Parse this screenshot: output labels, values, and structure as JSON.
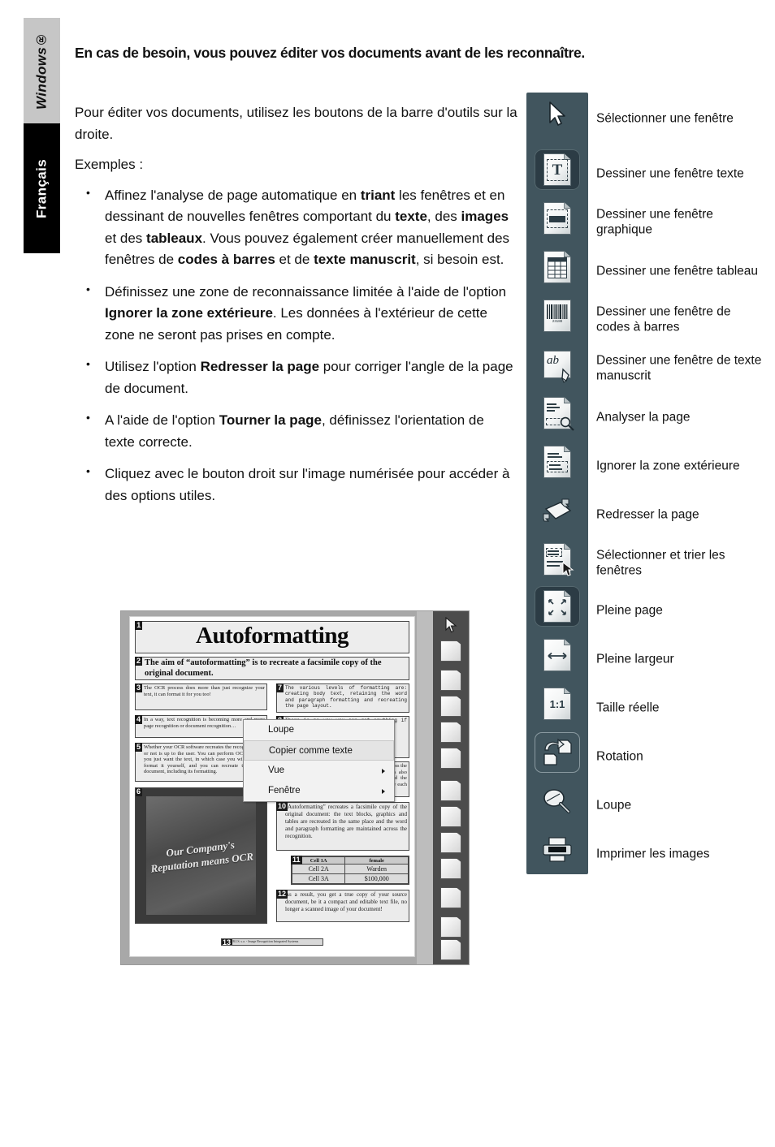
{
  "side_tabs": {
    "windows": "Windows®",
    "francais": "Français"
  },
  "heading": "En cas de besoin, vous pouvez éditer vos documents avant de les reconnaître.",
  "intro": {
    "paragraph": "Pour éditer vos documents, utilisez les boutons de la barre d'outils sur la droite.",
    "examples_label": "Exemples :"
  },
  "bullets": [
    {
      "p1": "Affinez l'analyse de page automatique en ",
      "b1": "triant",
      "p2": " les fenêtres et en dessinant de nouvelles fenêtres comportant du ",
      "b2": "texte",
      "p3": ", des ",
      "b3": "images",
      "p4": " et des ",
      "b4": "tableaux",
      "p5": ". Vous pouvez également créer manuellement des fenêtres de ",
      "b5": "codes à barres",
      "p6": " et de ",
      "b6": "texte manuscrit",
      "p7": ", si besoin est."
    },
    {
      "p1": "Définissez une zone de reconnaissance limitée à l'aide de l'option ",
      "b1": "Ignorer la zone extérieure",
      "p2": ". Les données à l'extérieur de cette zone ne seront pas prises en compte."
    },
    {
      "p1": "Utilisez l'option ",
      "b1": "Redresser la page",
      "p2": " pour corriger l'angle de la page de document."
    },
    {
      "p1": "A l'aide de l'option ",
      "b1": "Tourner la page",
      "p2": ", définissez l'orientation de texte correcte."
    },
    {
      "p1": "Cliquez avec le bouton droit sur l'image numérisée pour accéder à des options utiles."
    }
  ],
  "toolbar": {
    "panel_color": "#41555e",
    "items": [
      {
        "icon": "pointer-icon",
        "label": "Sélectionner une fenêtre",
        "state": "normal"
      },
      {
        "icon": "text-window-icon",
        "label": "Dessiner une fenêtre texte",
        "state": "pressed"
      },
      {
        "icon": "graphic-window-icon",
        "label": "Dessiner une fenêtre graphique",
        "state": "normal"
      },
      {
        "icon": "table-window-icon",
        "label": "Dessiner une fenêtre tableau",
        "state": "normal"
      },
      {
        "icon": "barcode-window-icon",
        "label": "Dessiner une fenêtre de codes à barres",
        "state": "normal"
      },
      {
        "icon": "handwriting-window-icon",
        "label": "Dessiner une fenêtre de texte manuscrit",
        "state": "normal"
      },
      {
        "icon": "analyze-page-icon",
        "label": "Analyser la page",
        "state": "normal"
      },
      {
        "icon": "ignore-outside-icon",
        "label": "Ignorer la zone extérieure",
        "state": "normal"
      },
      {
        "icon": "deskew-page-icon",
        "label": "Redresser la page",
        "state": "normal"
      },
      {
        "icon": "select-sort-icon",
        "label": "Sélectionner et trier les fenêtres",
        "state": "normal"
      },
      {
        "icon": "fit-page-icon",
        "label": "Pleine page",
        "state": "pressed"
      },
      {
        "icon": "fit-width-icon",
        "label": "Pleine largeur",
        "state": "normal"
      },
      {
        "icon": "actual-size-icon",
        "label": "Taille réelle",
        "state": "normal"
      },
      {
        "icon": "rotate-icon",
        "label": "Rotation",
        "state": "hover"
      },
      {
        "icon": "magnifier-icon",
        "label": "Loupe",
        "state": "normal"
      },
      {
        "icon": "printer-icon",
        "label": "Imprimer les images",
        "state": "normal"
      }
    ]
  },
  "screenshot": {
    "zones": {
      "z1_num": "1",
      "z1_text": "Autoformatting",
      "z2_num": "2",
      "z2_text": "The aim of “autoformatting” is to recreate a facsimile copy of the original document.",
      "z3_num": "3",
      "z3_text": "The OCR process does more than just recognize your text, it can format it for you too!",
      "z4_num": "4",
      "z4_text": "In a way, text recognition is becoming more and more page recognition or document recognition…",
      "z5_num": "5",
      "z5_text": "Whether your OCR software recreates the recognized text or not is up to the user. You can perform OCR because you just want the text, in which case you will edit and format it yourself, and you can recreate the source document, including its formatting.",
      "z6_num": "6",
      "z6_text": "Our Company's Reputation means OCR",
      "z7_num": "7",
      "z7_text": "The various levels of formatting are: creating body text, retaining the word and paragraph formatting and recreating the page layout.",
      "z8_num": "8",
      "z8_text": "There is no way you can get anything if you recreate by it.",
      "z9_num": "9",
      "z9_text": "The font type, size and typestyle are maintained across the recognition. The justification of the paragraphs is also detected. However, no graphics are captured and the columns aren't recreated - the paragraphs just follow each other etc.",
      "z10_num": "10",
      "z10_text": "“Autoformatting” recreates a facsimile copy of the original document: the text blocks, graphics and tables are recreated in the same place and the word and paragraph formatting are maintained across the recognition.",
      "z11_num": "11",
      "z11_table": {
        "rows": [
          [
            "Cell 1A",
            "female"
          ],
          [
            "Cell 2A",
            "Warden"
          ],
          [
            "Cell 3A",
            "$100,000"
          ]
        ]
      },
      "z12_num": "12",
      "z12_text": "As a result, you get a true copy of your source document, be it a compact and editable text file, no longer a scanned image of your document!",
      "z13_num": "13",
      "z13_text": "I.R.I.S. s.a. - Image Recognition Integrated Systems"
    },
    "context_menu": [
      {
        "label": "Loupe",
        "highlighted": false,
        "submenu": false
      },
      {
        "label": "Copier comme texte",
        "highlighted": true,
        "submenu": false
      },
      {
        "label": "Vue",
        "highlighted": false,
        "submenu": true
      },
      {
        "label": "Fenêtre",
        "highlighted": false,
        "submenu": true
      }
    ]
  }
}
